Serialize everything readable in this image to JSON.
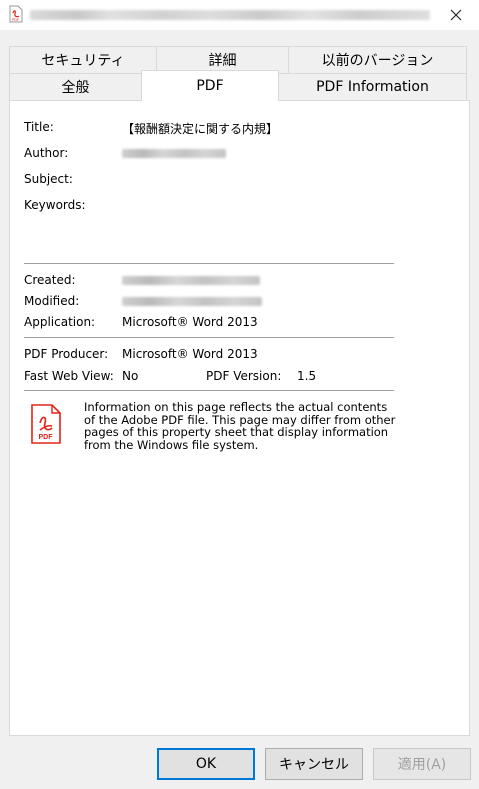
{
  "window": {
    "close_icon": "close-icon"
  },
  "tabs": {
    "row1": [
      "セキュリティ",
      "詳細",
      "以前のバージョン"
    ],
    "row2": [
      "全般",
      "PDF",
      "PDF Information"
    ],
    "active": "PDF"
  },
  "fields": {
    "title_label": "Title:",
    "title_value": "【報酬額決定に関する内規】",
    "author_label": "Author:",
    "subject_label": "Subject:",
    "keywords_label": "Keywords:",
    "created_label": "Created:",
    "modified_label": "Modified:",
    "application_label": "Application:",
    "application_value": "Microsoft® Word 2013",
    "producer_label": "PDF Producer:",
    "producer_value": "Microsoft® Word 2013",
    "fastweb_label": "Fast Web View:",
    "fastweb_value": "No",
    "version_label": "PDF Version:",
    "version_value": "1.5"
  },
  "info": {
    "icon": "pdf-file-icon",
    "text": "Information on this page reflects the actual contents\nof the Adobe PDF file. This page may differ from other\npages of this property sheet that display information\nfrom the Windows file system."
  },
  "buttons": {
    "ok": "OK",
    "cancel": "キャンセル",
    "apply": "適用(A)"
  },
  "colors": {
    "accent": "#0078d7",
    "pdf_red": "#e2231a"
  }
}
